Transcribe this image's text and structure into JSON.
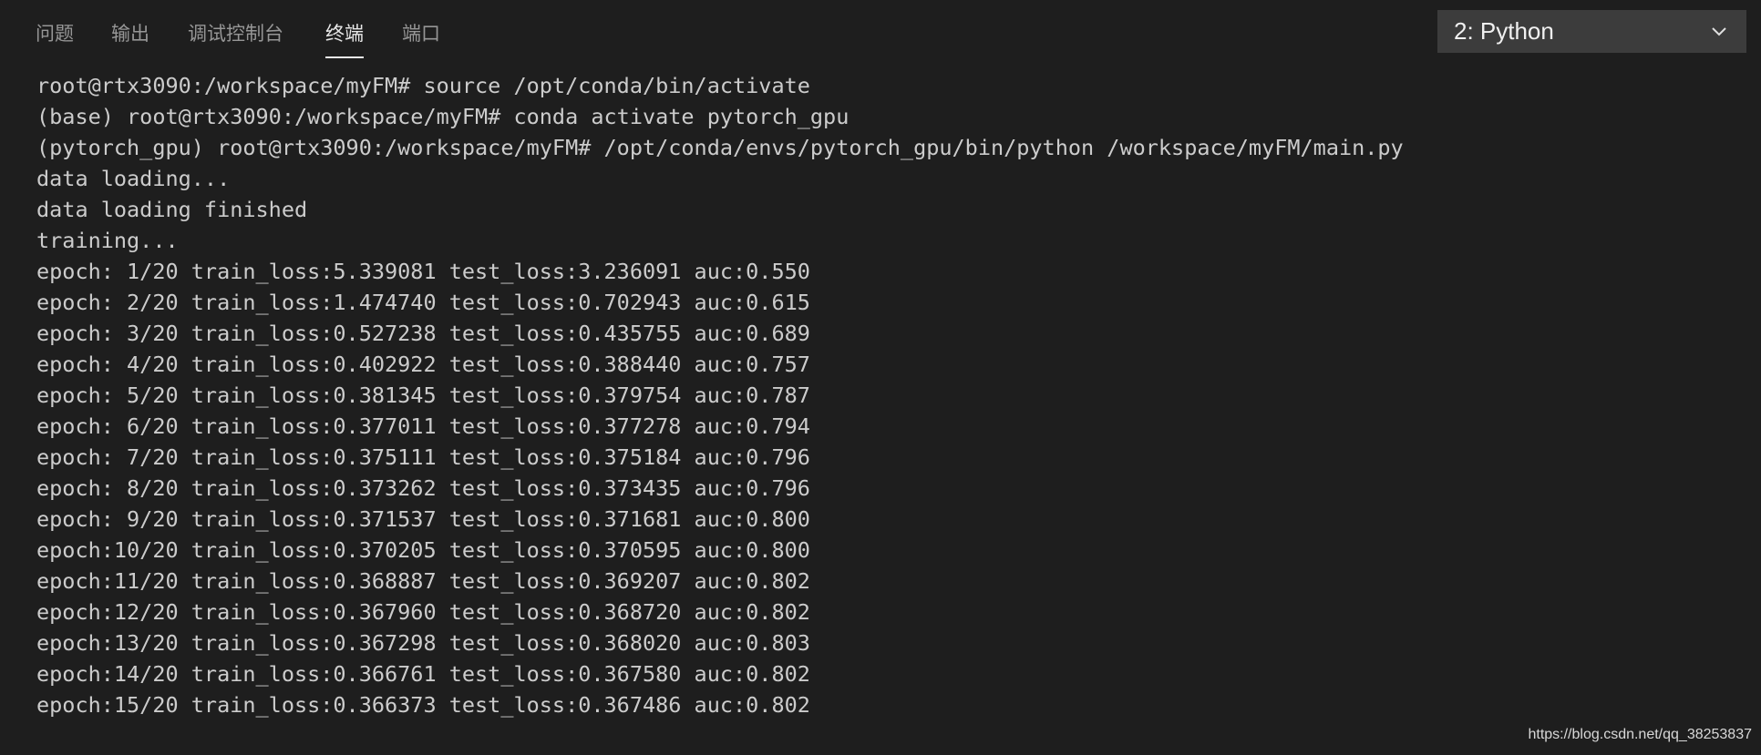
{
  "tabs": [
    {
      "label": "问题",
      "active": false
    },
    {
      "label": "输出",
      "active": false
    },
    {
      "label": "调试控制台",
      "active": false
    },
    {
      "label": "终端",
      "active": true
    },
    {
      "label": "端口",
      "active": false
    }
  ],
  "terminal_selector": {
    "selected": "2: Python",
    "icon": "chevron-down-icon"
  },
  "terminal": {
    "lines": [
      "root@rtx3090:/workspace/myFM# source /opt/conda/bin/activate",
      "(base) root@rtx3090:/workspace/myFM# conda activate pytorch_gpu",
      "(pytorch_gpu) root@rtx3090:/workspace/myFM# /opt/conda/envs/pytorch_gpu/bin/python /workspace/myFM/main.py",
      "data loading...",
      "data loading finished",
      "training...",
      "epoch: 1/20 train_loss:5.339081 test_loss:3.236091 auc:0.550",
      "epoch: 2/20 train_loss:1.474740 test_loss:0.702943 auc:0.615",
      "epoch: 3/20 train_loss:0.527238 test_loss:0.435755 auc:0.689",
      "epoch: 4/20 train_loss:0.402922 test_loss:0.388440 auc:0.757",
      "epoch: 5/20 train_loss:0.381345 test_loss:0.379754 auc:0.787",
      "epoch: 6/20 train_loss:0.377011 test_loss:0.377278 auc:0.794",
      "epoch: 7/20 train_loss:0.375111 test_loss:0.375184 auc:0.796",
      "epoch: 8/20 train_loss:0.373262 test_loss:0.373435 auc:0.796",
      "epoch: 9/20 train_loss:0.371537 test_loss:0.371681 auc:0.800",
      "epoch:10/20 train_loss:0.370205 test_loss:0.370595 auc:0.800",
      "epoch:11/20 train_loss:0.368887 test_loss:0.369207 auc:0.802",
      "epoch:12/20 train_loss:0.367960 test_loss:0.368720 auc:0.802",
      "epoch:13/20 train_loss:0.367298 test_loss:0.368020 auc:0.803",
      "epoch:14/20 train_loss:0.366761 test_loss:0.367580 auc:0.802",
      "epoch:15/20 train_loss:0.366373 test_loss:0.367486 auc:0.802"
    ]
  },
  "watermark": "https://blog.csdn.net/qq_38253837",
  "colors": {
    "background": "#1e1e1e",
    "dropdown_background": "#3c3c3c",
    "text": "#cccccc",
    "tab_inactive": "#969696",
    "tab_active": "#e7e7e7"
  }
}
